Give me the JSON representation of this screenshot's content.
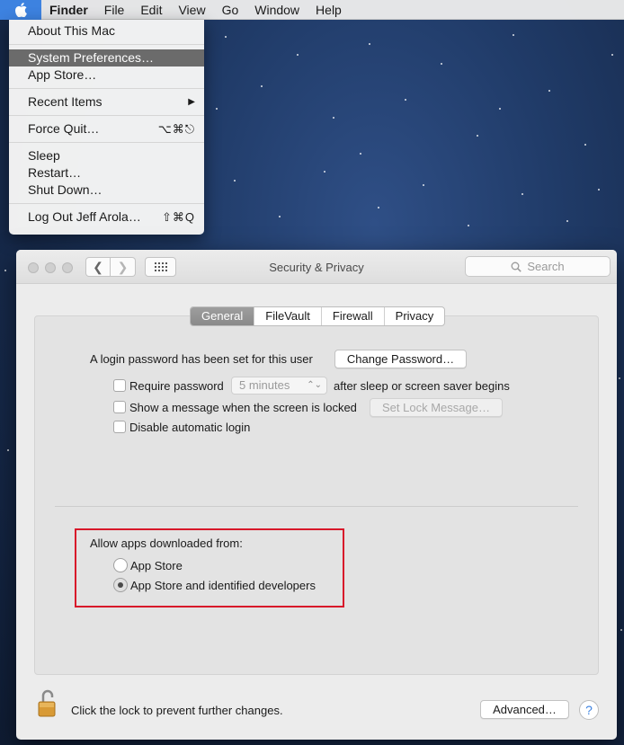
{
  "menubar": {
    "app_name": "Finder",
    "menus": [
      "File",
      "Edit",
      "View",
      "Go",
      "Window",
      "Help"
    ]
  },
  "apple_menu": {
    "about": "About This Mac",
    "system_prefs": "System Preferences…",
    "app_store": "App Store…",
    "recent_items": "Recent Items",
    "force_quit": "Force Quit…",
    "force_quit_shortcut": "⌥⌘⎋",
    "sleep": "Sleep",
    "restart": "Restart…",
    "shut_down": "Shut Down…",
    "log_out": "Log Out Jeff Arola…",
    "log_out_shortcut": "⇧⌘Q"
  },
  "window": {
    "title": "Security & Privacy",
    "search_placeholder": "Search",
    "tabs": [
      "General",
      "FileVault",
      "Firewall",
      "Privacy"
    ],
    "active_tab": "General",
    "password_label": "A login password has been set for this user",
    "change_password": "Change Password…",
    "require_password": "Require password",
    "require_password_value": "5 minutes",
    "require_password_suffix": "after sleep or screen saver begins",
    "show_message": "Show a message when the screen is locked",
    "set_lock_message": "Set Lock Message…",
    "disable_auto_login": "Disable automatic login",
    "allow_apps_label": "Allow apps downloaded from:",
    "option_app_store": "App Store",
    "option_identified": "App Store and identified developers",
    "selected_option": "App Store and identified developers",
    "lock_text": "Click the lock to prevent further changes.",
    "advanced": "Advanced…",
    "help": "?"
  },
  "colors": {
    "highlight_box": "#d8182a",
    "menu_selection": "#6b6b6b",
    "accent": "#3d82e0"
  }
}
